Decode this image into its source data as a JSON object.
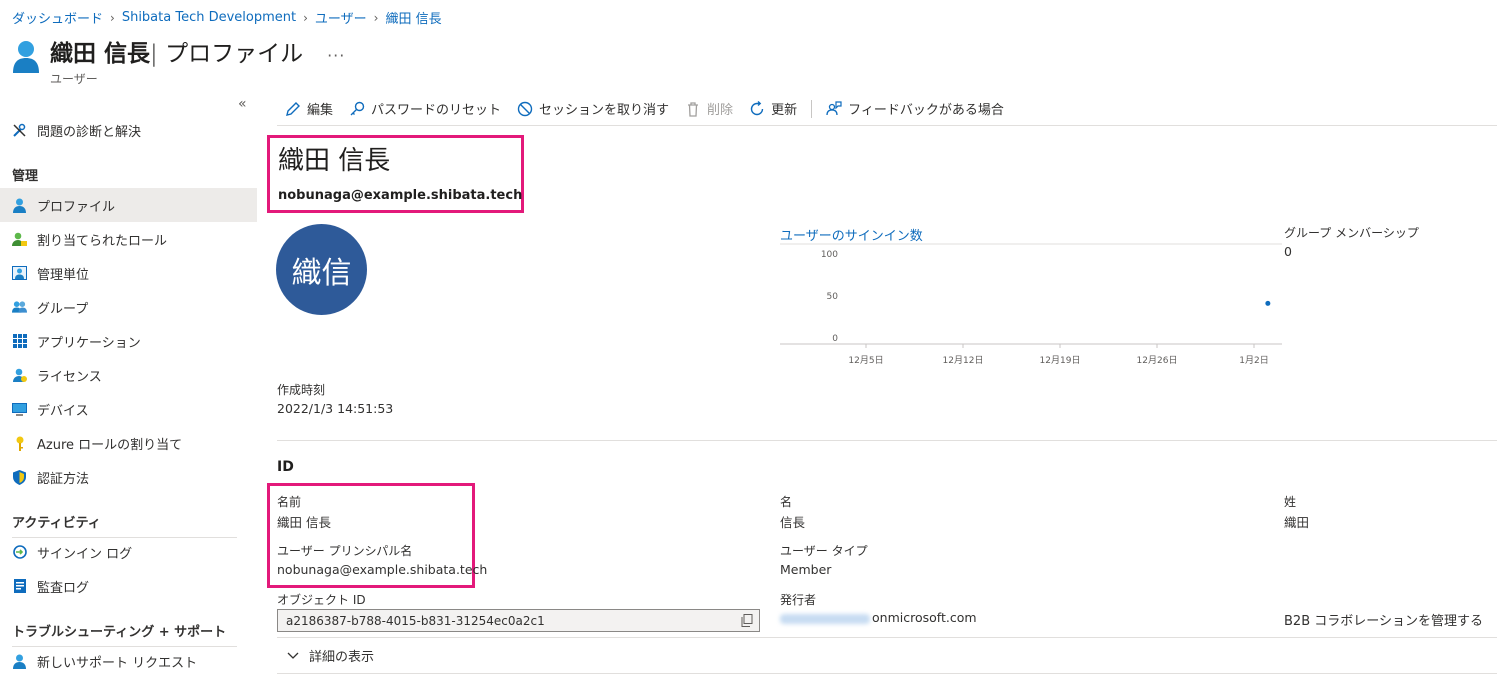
{
  "breadcrumb": [
    "ダッシュボード",
    "Shibata Tech Development",
    "ユーザー",
    "織田 信長"
  ],
  "header": {
    "title": "織田 信長",
    "subtitle": " | プロファイル",
    "more": "···",
    "type": "ユーザー"
  },
  "sidebar": {
    "collapse": "«",
    "diagnose": "問題の診断と解決",
    "section_manage": "管理",
    "items_manage": [
      "プロファイル",
      "割り当てられたロール",
      "管理単位",
      "グループ",
      "アプリケーション",
      "ライセンス",
      "デバイス",
      "Azure ロールの割り当て",
      "認証方法"
    ],
    "section_activity": "アクティビティ",
    "items_activity": [
      "サインイン ログ",
      "監査ログ"
    ],
    "section_support": "トラブルシューティング + サポート",
    "items_support": [
      "新しいサポート リクエスト"
    ]
  },
  "toolbar": {
    "edit": "編集",
    "reset_password": "パスワードのリセット",
    "revoke_sessions": "セッションを取り消す",
    "delete": "削除",
    "refresh": "更新",
    "feedback": "フィードバックがある場合"
  },
  "profile": {
    "display_name": "織田 信長",
    "upn": "nobunaga@example.shibata.tech",
    "avatar_initials": "織信",
    "created_label": "作成時刻",
    "created_value": "2022/1/3 14:51:53"
  },
  "signins": {
    "title": "ユーザーのサインイン数"
  },
  "groups": {
    "label": "グループ メンバーシップ",
    "value": "0"
  },
  "identity": {
    "title": "ID",
    "name_label": "名前",
    "name_value": "織田 信長",
    "given_label": "名",
    "given_value": "信長",
    "surname_label": "姓",
    "surname_value": "織田",
    "upn_label": "ユーザー プリンシパル名",
    "upn_value": "nobunaga@example.shibata.tech",
    "usertype_label": "ユーザー タイプ",
    "usertype_value": "Member",
    "objectid_label": "オブジェクト ID",
    "objectid_value": "a2186387-b788-4015-b831-31254ec0a2c1",
    "issuer_label": "発行者",
    "issuer_value": "onmicrosoft.com",
    "b2b_link": "B2B コラボレーションを管理する",
    "show_details": "詳細の表示"
  },
  "chart_data": {
    "type": "scatter",
    "title": "ユーザーのサインイン数",
    "xlabel": "",
    "ylabel": "",
    "x_ticks": [
      "12月5日",
      "12月12日",
      "12月19日",
      "12月26日",
      "1月2日"
    ],
    "y_ticks": [
      0,
      50,
      100
    ],
    "ylim": [
      0,
      100
    ],
    "series": [
      {
        "points": [
          {
            "x": "1月3日",
            "y": 40
          }
        ]
      }
    ],
    "grid": false,
    "colors": {
      "point": "#0f6cbd"
    }
  },
  "colors": {
    "accent": "#0f6cbd",
    "highlight": "#e3197a",
    "avatar": "#2e5a99"
  }
}
